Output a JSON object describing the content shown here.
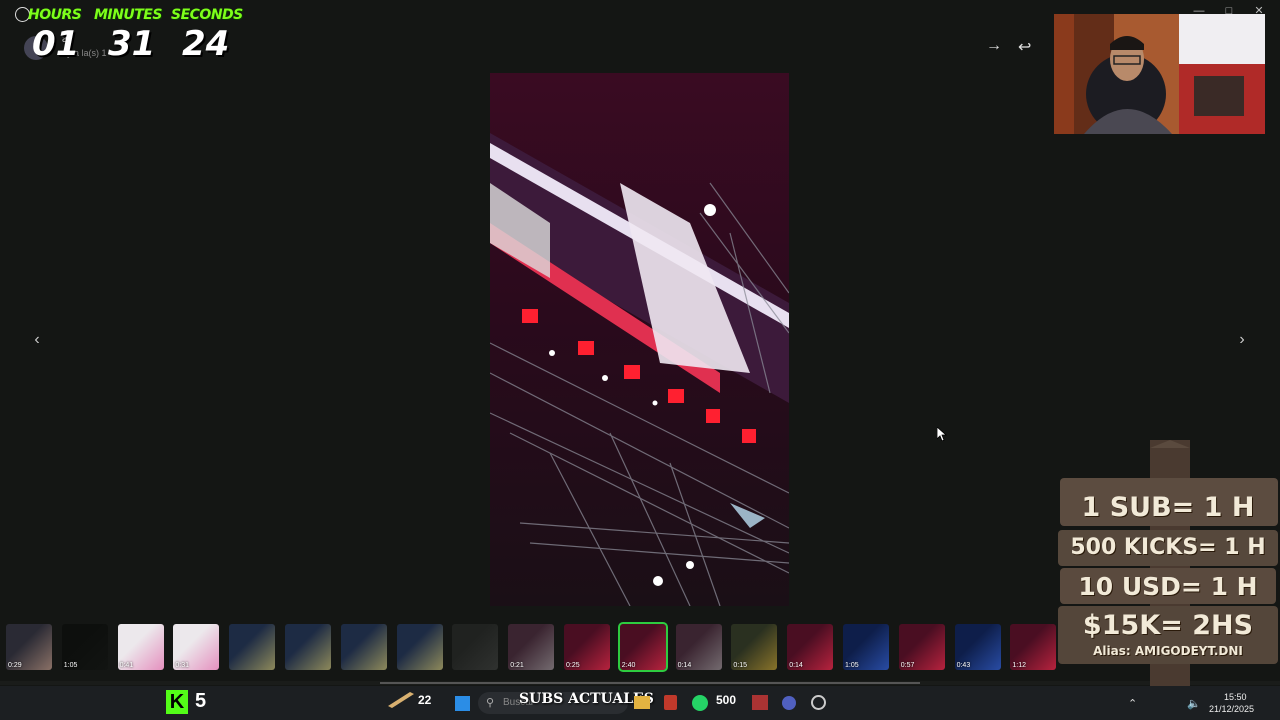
{
  "timer": {
    "labels": {
      "hours": "HOURS",
      "minutes": "MINUTES",
      "seconds": "SECONDS"
    },
    "values": {
      "hours": "01",
      "minutes": "31",
      "seconds": "24"
    }
  },
  "chat_header": {
    "name_fragment": "o",
    "sub_fragment": "a",
    "status_fragment": "oy a la(s) 1"
  },
  "toolbar": {
    "forward_icon": "arrow-right-icon",
    "reply_icon": "reply-icon"
  },
  "viewer": {
    "prev_icon": "chevron-left-icon",
    "next_icon": "chevron-right-icon"
  },
  "thumbnails": [
    {
      "dur": "0:29",
      "kind": "face"
    },
    {
      "dur": "1:05",
      "kind": "dark"
    },
    {
      "dur": "0:41",
      "kind": "pink"
    },
    {
      "dur": "0:31",
      "kind": "pink"
    },
    {
      "dur": "",
      "kind": "doc"
    },
    {
      "dur": "",
      "kind": "doc"
    },
    {
      "dur": "",
      "kind": "doc"
    },
    {
      "dur": "",
      "kind": "doc"
    },
    {
      "dur": "",
      "kind": "gray"
    },
    {
      "dur": "0:21",
      "kind": "truss"
    },
    {
      "dur": "0:25",
      "kind": "red"
    },
    {
      "dur": "2:40",
      "kind": "red",
      "selected": true
    },
    {
      "dur": "0:14",
      "kind": "truss"
    },
    {
      "dur": "0:15",
      "kind": "green"
    },
    {
      "dur": "0:14",
      "kind": "red"
    },
    {
      "dur": "1:05",
      "kind": "blue"
    },
    {
      "dur": "0:57",
      "kind": "red"
    },
    {
      "dur": "0:43",
      "kind": "blue"
    },
    {
      "dur": "1:12",
      "kind": "red"
    }
  ],
  "sign": {
    "line1": "1 SUB= 1 H",
    "line2": "500 KICKS= 1 H",
    "line3": "10 USD= 1 H",
    "line4": "$15K= 2HS",
    "alias": "Alias: AMIGODEYT.DNI"
  },
  "taskbar": {
    "kick_logo": "K",
    "kick_count": "5",
    "bits_count": "22",
    "subs_label": "SUBS ACTUALES",
    "search_placeholder": "Buscar",
    "whatsapp_badge": "500",
    "time": "15:50",
    "date": "21/12/2025"
  },
  "colors": {
    "timer_label": "#7dff1a",
    "kick_green": "#53fc18",
    "selected_border": "#2ecc40"
  }
}
